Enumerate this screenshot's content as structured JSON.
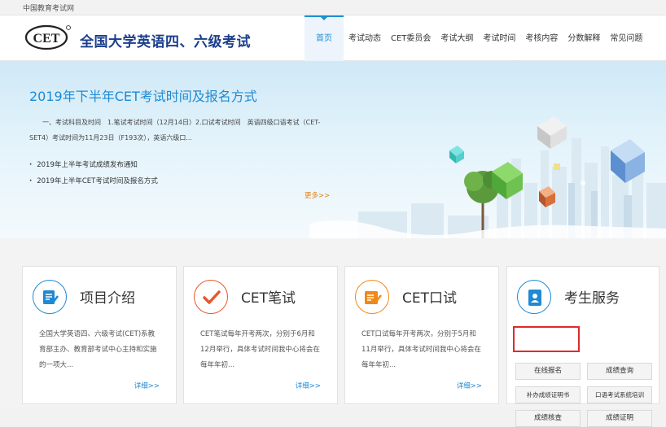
{
  "topbar": {
    "text": "中国教育考试网"
  },
  "header": {
    "logo_text": "CET",
    "site_title": "全国大学英语四、六级考试",
    "nav": [
      "首页",
      "考试动态",
      "CET委员会",
      "考试大纲",
      "考试时间",
      "考核内容",
      "分数解释",
      "常见问题"
    ]
  },
  "banner": {
    "title": "2019年下半年CET考试时间及报名方式",
    "desc": "一、考试科目及时间　1.笔试考试时间（12月14日）2.口试考试时间　英语四级口语考试（CET-SET4）考试时间为11月23日（F193次），英语六级口...",
    "news": [
      "2019年上半年考试成绩发布通知",
      "2019年上半年CET考试时间及报名方式"
    ],
    "more": "更多>>"
  },
  "cards": [
    {
      "title": "项目介绍",
      "desc": "全国大学英语四、六级考试(CET)系教育部主办、教育部考试中心主持和实施的一项大...",
      "more": "详细>>",
      "icon": "document-icon",
      "color": "#1f8ad3"
    },
    {
      "title": "CET笔试",
      "desc": "CET笔试每年开考两次，分别于6月和12月举行，具体考试时间我中心将会在每年年初...",
      "more": "详细>>",
      "icon": "checkmark-icon",
      "color": "#e8562c"
    },
    {
      "title": "CET口试",
      "desc": "CET口试每年开考两次，分别于5月和11月举行，具体考试时间我中心将会在每年年初...",
      "more": "详细>>",
      "icon": "clipboard-pen-icon",
      "color": "#ee8a18"
    }
  ],
  "service": {
    "title": "考生服务",
    "icon": "id-card-icon",
    "color": "#1f8ad3",
    "buttons": [
      "在线报名",
      "成绩查询",
      "补办成绩证明书",
      "口语考试系统培训",
      "成绩核查",
      "成绩证明"
    ]
  }
}
